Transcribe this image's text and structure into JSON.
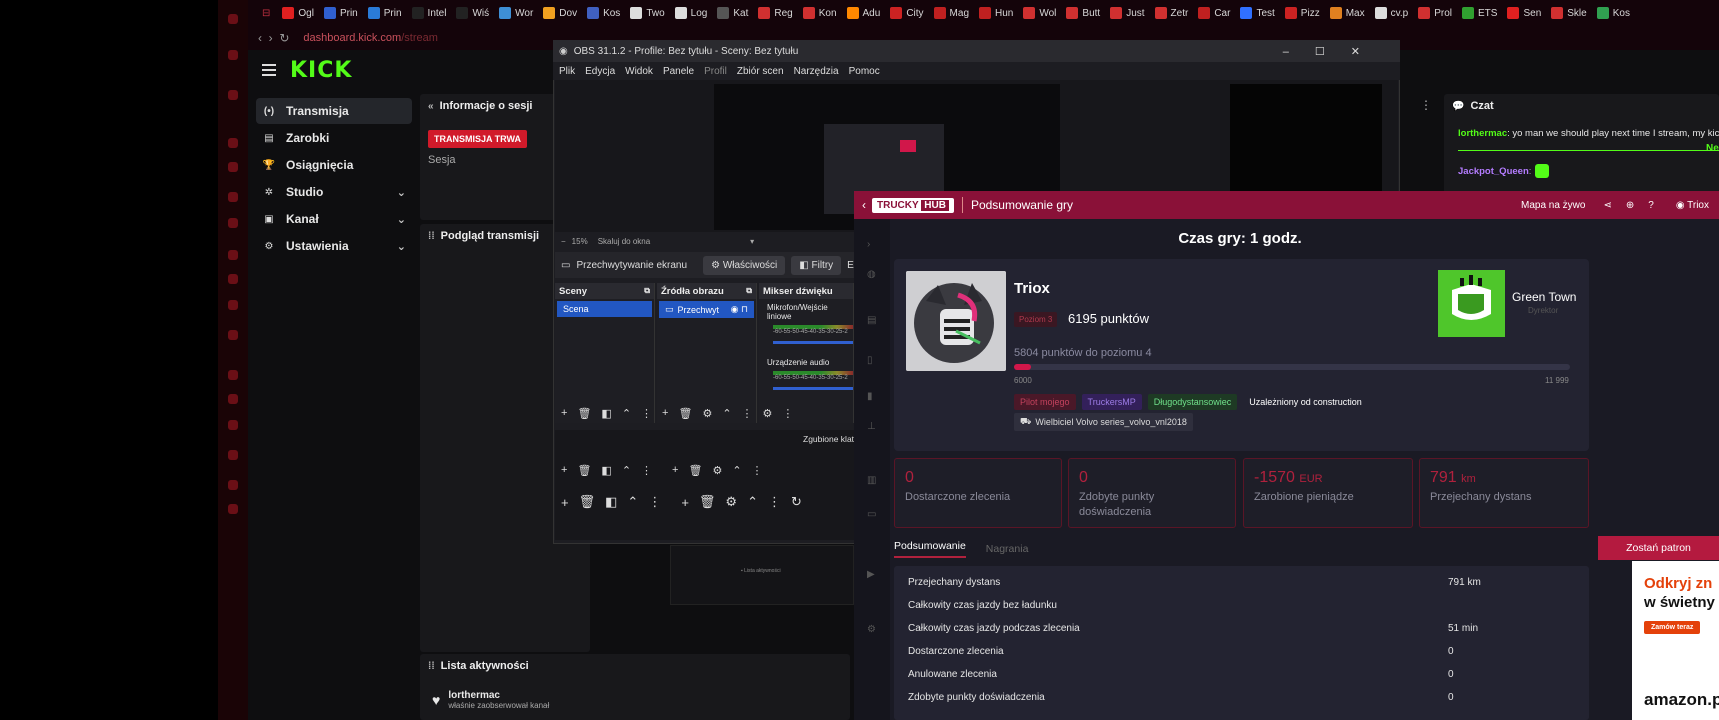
{
  "bookmarks": [
    {
      "label": "Ogl",
      "color": "#e02020"
    },
    {
      "label": "Prin",
      "color": "#3060d0"
    },
    {
      "label": "Prin",
      "color": "#2a7bd8"
    },
    {
      "label": "Intel",
      "color": "#222"
    },
    {
      "label": "Wiś",
      "color": "#222"
    },
    {
      "label": "Wor",
      "color": "#3e8fd5"
    },
    {
      "label": "Dov",
      "color": "#f0a020"
    },
    {
      "label": "Kos",
      "color": "#4060c0"
    },
    {
      "label": "Two",
      "color": "#ddd"
    },
    {
      "label": "Log",
      "color": "#ddd"
    },
    {
      "label": "Kat",
      "color": "#555"
    },
    {
      "label": "Reg",
      "color": "#d03030"
    },
    {
      "label": "Kon",
      "color": "#d03030"
    },
    {
      "label": "Adu",
      "color": "#ff8800"
    },
    {
      "label": "City",
      "color": "#cc2222"
    },
    {
      "label": "Mag",
      "color": "#c02020"
    },
    {
      "label": "Hun",
      "color": "#c02020"
    },
    {
      "label": "Wol",
      "color": "#d03030"
    },
    {
      "label": "Butt",
      "color": "#d03030"
    },
    {
      "label": "Just",
      "color": "#d03030"
    },
    {
      "label": "Zetr",
      "color": "#d03030"
    },
    {
      "label": "Car",
      "color": "#c02020"
    },
    {
      "label": "Test",
      "color": "#3070ff"
    },
    {
      "label": "Pizz",
      "color": "#cc2222"
    },
    {
      "label": "Max",
      "color": "#e08020"
    },
    {
      "label": "cv.p",
      "color": "#ddd"
    },
    {
      "label": "Prol",
      "color": "#d03030"
    },
    {
      "label": "ETS",
      "color": "#30a030"
    },
    {
      "label": "Sen",
      "color": "#e02020"
    },
    {
      "label": "Skle",
      "color": "#d03030"
    },
    {
      "label": "Kos",
      "color": "#30a050"
    }
  ],
  "url": {
    "host": "dashboard.kick.com",
    "path": "/stream"
  },
  "kick": {
    "logo": "KICK",
    "nav": [
      {
        "icon": "(•)",
        "label": "Transmisja",
        "active": true
      },
      {
        "icon": "▤",
        "label": "Zarobki"
      },
      {
        "icon": "🏆",
        "label": "Osiągnięcia"
      },
      {
        "icon": "✲",
        "label": "Studio",
        "expand": true
      },
      {
        "icon": "▣",
        "label": "Kanał",
        "expand": true
      },
      {
        "icon": "⚙",
        "label": "Ustawienia",
        "expand": true
      }
    ],
    "session_title": "Informacje o sesji",
    "live_badge": "TRANSMISJA TRWA",
    "session_label": "Sesja",
    "preview_title": "Podgląd transmisji",
    "activity_title": "Lista aktywności",
    "activity_user": "lorthermac",
    "activity_action": "właśnie zaobserwował kanał",
    "chat_title": "Czat",
    "chat_msg_user": "lorthermac",
    "chat_msg_text": ": yo man we should play next time I stream, my kick i",
    "chat_user2": "Jackpot_Queen",
    "chat_ne": "Ne"
  },
  "obs": {
    "title": "OBS 31.1.2 - Profile: Bez tytułu - Sceny: Bez tytułu",
    "menu": [
      "Plik",
      "Edycja",
      "Widok",
      "Panele",
      "Profil",
      "Zbiór scen",
      "Narzędzia",
      "Pomoc"
    ],
    "zoom": "15%",
    "fit": "Skaluj do okna",
    "source_label": "Przechwytywanie ekranu",
    "properties": "Właściwości",
    "filters": "Filtry",
    "screen": "Ekra",
    "scenes_title": "Sceny",
    "scene_item": "Scena",
    "sources_title": "Źródła obrazu",
    "source_item": "Przechwyt",
    "mixer_title": "Mikser dźwięku",
    "mixer_ch1": "Mikrofon/Wejście liniowe",
    "mixer_ch2": "Urządzenie audio",
    "db_scale": "-60-55-50-45-40-35-30-25-2",
    "dropped": "Zgubione klat"
  },
  "trucky": {
    "logo_a": "TRUCKY",
    "logo_b": "HUB",
    "page_title": "Podsumowanie gry",
    "map_link": "Mapa na żywo",
    "user": "Triox",
    "time_title": "Czas gry: 1 godz.",
    "player_name": "Triox",
    "rank": "Poziom 3",
    "points": "6195 punktów",
    "level_progress": "5804 punktów do poziomu 4",
    "level_fraction": 0.03,
    "xp_min": "6000",
    "xp_max": "11 999",
    "tags": [
      {
        "label": "Pilot mojego",
        "bg": "#4a1828",
        "fg": "#c3425d"
      },
      {
        "label": "TruckersMP",
        "bg": "#33205a",
        "fg": "#9c7ce6"
      },
      {
        "label": "Długodystansowiec",
        "bg": "#1e3a24",
        "fg": "#6fe08a"
      },
      {
        "label": "Uzależniony od construction",
        "bg": "transparent",
        "fg": "#ffffff"
      }
    ],
    "tag2": "Wielbiciel Volvo series_volvo_vnl2018",
    "company_name": "Green Town",
    "company_sub": "Dyrektor",
    "stats": [
      {
        "value": "0",
        "unit": "",
        "label": "Dostarczone zlecenia"
      },
      {
        "value": "0",
        "unit": "",
        "label": "Zdobyte punkty doświadczenia"
      },
      {
        "value": "-1570",
        "unit": "EUR",
        "label": "Zarobione pieniądze"
      },
      {
        "value": "791",
        "unit": "km",
        "label": "Przejechany dystans"
      }
    ],
    "tab_summary": "Podsumowanie",
    "tab_recordings": "Nagrania",
    "rows": [
      {
        "k": "Przejechany dystans",
        "v": "791 km"
      },
      {
        "k": "Całkowity czas jazdy bez ładunku",
        "v": ""
      },
      {
        "k": "Całkowity czas jazdy podczas zlecenia",
        "v": "51 min"
      },
      {
        "k": "Dostarczone zlecenia",
        "v": "0"
      },
      {
        "k": "Anulowane zlecenia",
        "v": "0"
      },
      {
        "k": "Zdobyte punkty doświadczenia",
        "v": "0"
      }
    ],
    "patron_btn": "Zostań patron",
    "ad_line1": "Odkryj zn",
    "ad_line2": "w świetny",
    "ad_btn": "Zamów teraz",
    "ad_brand": "amazon.pl"
  }
}
